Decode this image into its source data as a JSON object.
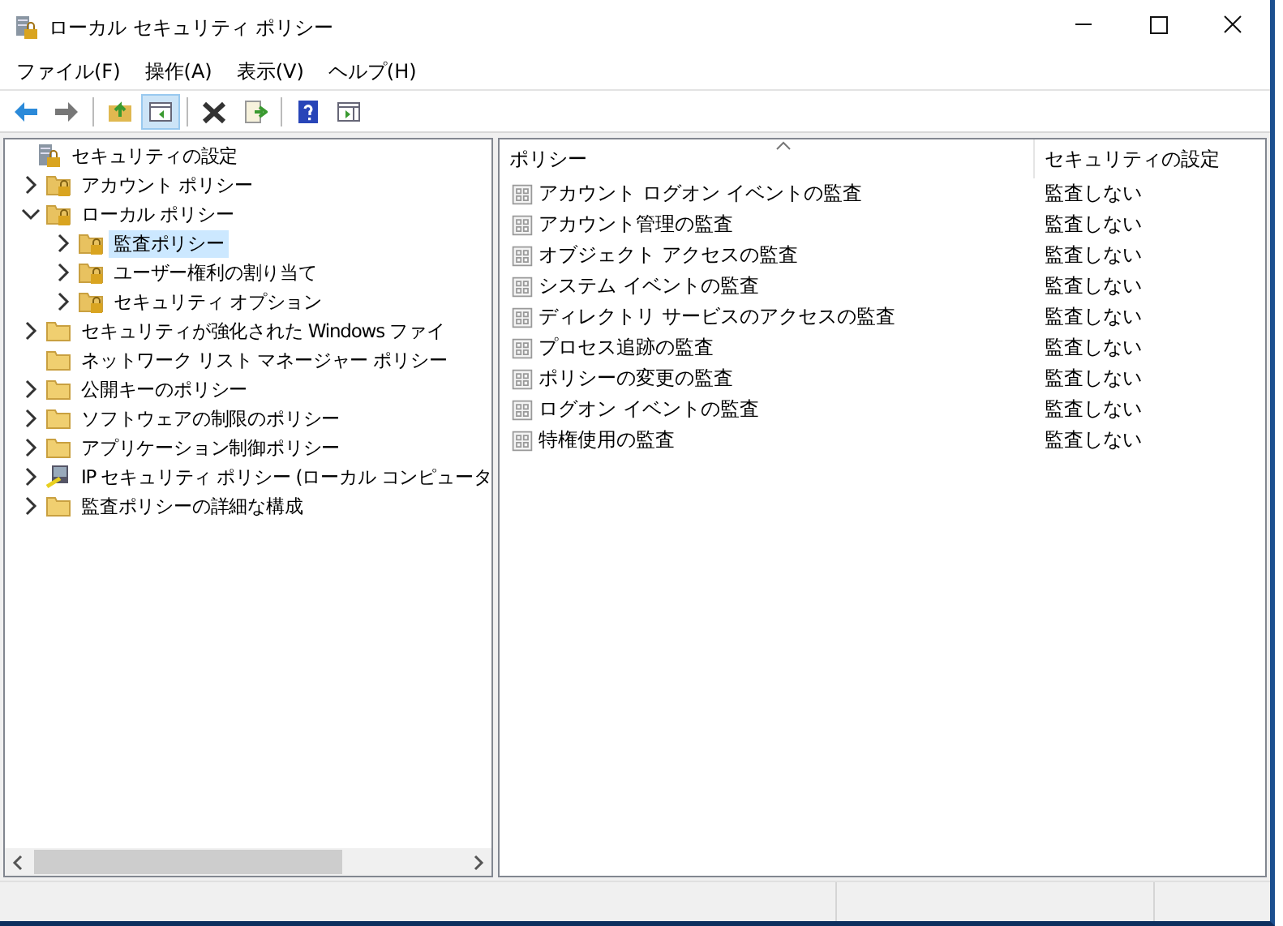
{
  "window": {
    "title": "ローカル セキュリティ ポリシー"
  },
  "menu": [
    {
      "label": "ファイル(F)"
    },
    {
      "label": "操作(A)"
    },
    {
      "label": "表示(V)"
    },
    {
      "label": "ヘルプ(H)"
    }
  ],
  "toolbar": [
    {
      "kind": "back",
      "pressed": false
    },
    {
      "kind": "forward",
      "pressed": false
    },
    {
      "kind": "sep"
    },
    {
      "kind": "up",
      "pressed": false
    },
    {
      "kind": "tree",
      "pressed": true
    },
    {
      "kind": "sep"
    },
    {
      "kind": "delete",
      "pressed": false
    },
    {
      "kind": "export",
      "pressed": false
    },
    {
      "kind": "sep"
    },
    {
      "kind": "help",
      "pressed": false
    },
    {
      "kind": "pane",
      "pressed": false
    }
  ],
  "tree": {
    "label": "セキュリティの設定",
    "kind": "root",
    "selected": false,
    "children": [
      {
        "label": "アカウント ポリシー",
        "kind": "lockfolder",
        "expandable": true,
        "expanded": false,
        "selected": false
      },
      {
        "label": "ローカル ポリシー",
        "kind": "lockfolder",
        "expandable": true,
        "expanded": true,
        "selected": false,
        "children": [
          {
            "label": "監査ポリシー",
            "kind": "lockfolder",
            "expandable": true,
            "expanded": false,
            "selected": true
          },
          {
            "label": "ユーザー権利の割り当て",
            "kind": "lockfolder",
            "expandable": true,
            "expanded": false,
            "selected": false
          },
          {
            "label": "セキュリティ オプション",
            "kind": "lockfolder",
            "expandable": true,
            "expanded": false,
            "selected": false
          }
        ]
      },
      {
        "label": "セキュリティが強化された Windows ファイ",
        "kind": "folder",
        "expandable": true,
        "expanded": false,
        "selected": false
      },
      {
        "label": "ネットワーク リスト マネージャー ポリシー",
        "kind": "folder",
        "expandable": false,
        "selected": false
      },
      {
        "label": "公開キーのポリシー",
        "kind": "folder",
        "expandable": true,
        "expanded": false,
        "selected": false
      },
      {
        "label": "ソフトウェアの制限のポリシー",
        "kind": "folder",
        "expandable": true,
        "expanded": false,
        "selected": false
      },
      {
        "label": "アプリケーション制御ポリシー",
        "kind": "folder",
        "expandable": true,
        "expanded": false,
        "selected": false
      },
      {
        "label": "IP セキュリティ ポリシー (ローカル コンピュータ",
        "kind": "ipsec",
        "expandable": true,
        "expanded": false,
        "selected": false
      },
      {
        "label": "監査ポリシーの詳細な構成",
        "kind": "folder",
        "expandable": true,
        "expanded": false,
        "selected": false
      }
    ]
  },
  "table": {
    "columns": [
      {
        "label": "ポリシー"
      },
      {
        "label": "セキュリティの設定"
      }
    ],
    "rows": [
      {
        "policy": "アカウント ログオン イベントの監査",
        "setting": "監査しない"
      },
      {
        "policy": "アカウント管理の監査",
        "setting": "監査しない"
      },
      {
        "policy": "オブジェクト アクセスの監査",
        "setting": "監査しない"
      },
      {
        "policy": "システム イベントの監査",
        "setting": "監査しない"
      },
      {
        "policy": "ディレクトリ サービスのアクセスの監査",
        "setting": "監査しない"
      },
      {
        "policy": "プロセス追跡の監査",
        "setting": "監査しない"
      },
      {
        "policy": "ポリシーの変更の監査",
        "setting": "監査しない"
      },
      {
        "policy": "ログオン イベントの監査",
        "setting": "監査しない"
      },
      {
        "policy": "特権使用の監査",
        "setting": "監査しない"
      }
    ]
  }
}
